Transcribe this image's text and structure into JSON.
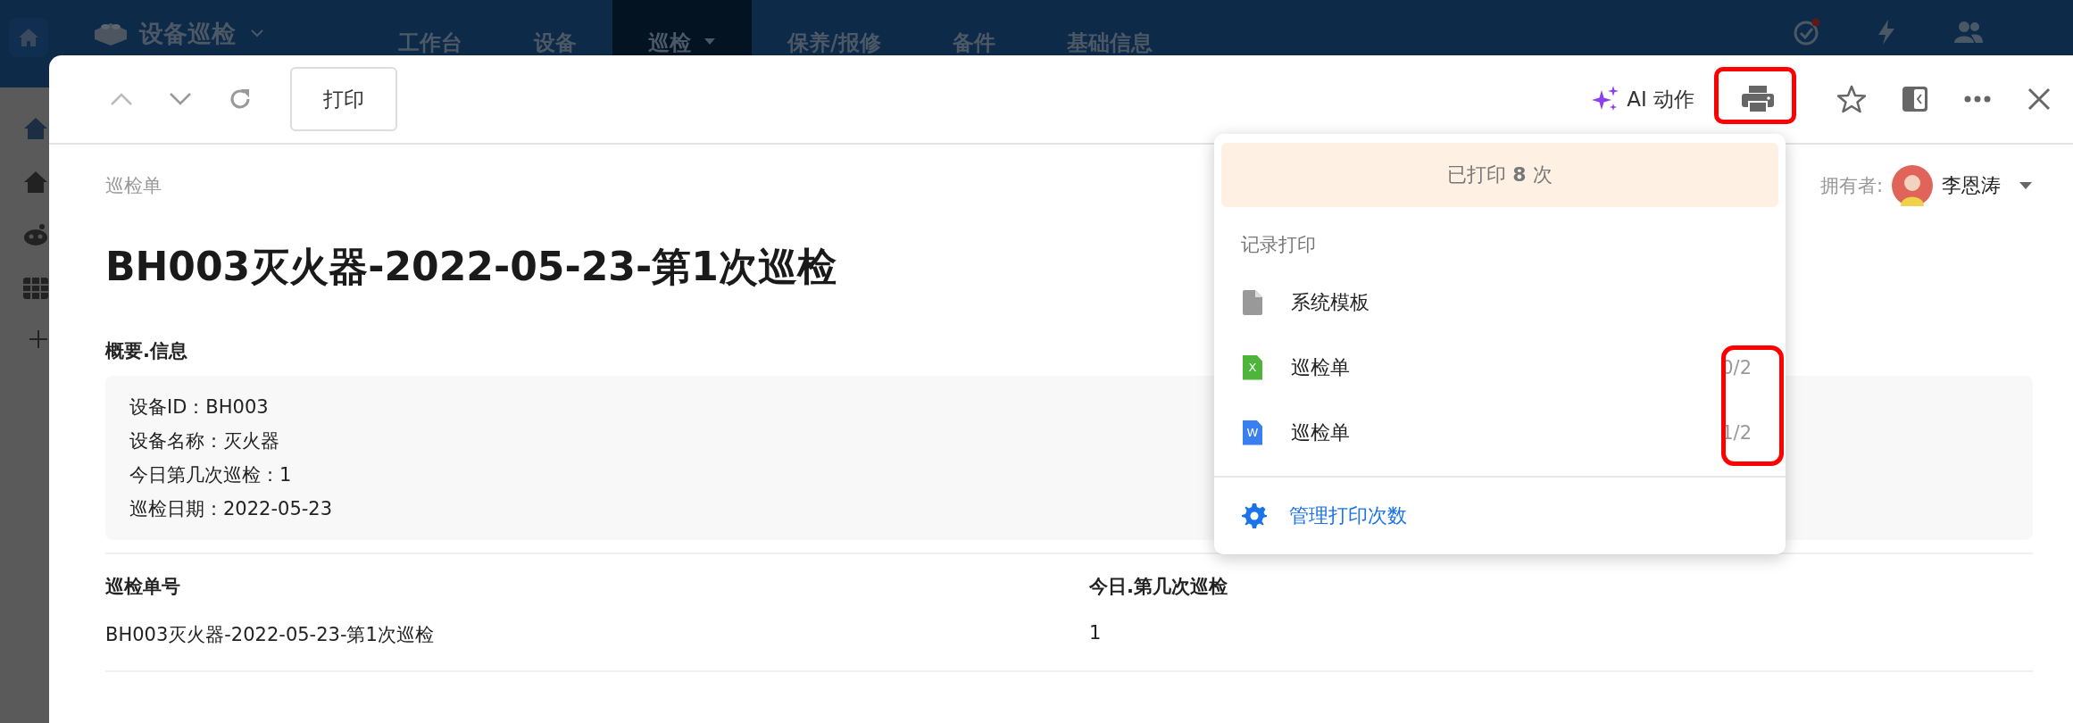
{
  "app_bar": {
    "title": "设备巡检",
    "nav": [
      {
        "label": "工作台",
        "selected": false,
        "has_menu": false
      },
      {
        "label": "设备",
        "selected": false,
        "has_menu": false
      },
      {
        "label": "巡检",
        "selected": true,
        "has_menu": true
      },
      {
        "label": "保养/报修",
        "selected": false,
        "has_menu": false
      },
      {
        "label": "备件",
        "selected": false,
        "has_menu": false
      },
      {
        "label": "基础信息",
        "selected": false,
        "has_menu": false
      }
    ]
  },
  "dialog": {
    "toolbar": {
      "print_button": "打印",
      "ai_action": "AI 动作"
    },
    "record_type": "巡检单",
    "owner": {
      "label": "拥有者:",
      "name": "李恩涛"
    },
    "title": "BH003灭火器-2022-05-23-第1次巡检",
    "summary": {
      "heading": "概要.信息",
      "lines": [
        "设备ID：BH003",
        "设备名称：灭火器",
        "今日第几次巡检：1",
        "巡检日期：2022-05-23"
      ]
    },
    "table": {
      "columns": [
        "巡检单号",
        "今日.第几次巡检"
      ],
      "rows": [
        [
          "BH003灭火器-2022-05-23-第1次巡检",
          "1"
        ]
      ]
    }
  },
  "print_menu": {
    "count_text": "已打印 **8** 次",
    "section_label": "记录打印",
    "templates": [
      {
        "kind": "system",
        "name": "系统模板"
      },
      {
        "kind": "excel",
        "badge": "X",
        "name": "巡检单",
        "count": "0/2"
      },
      {
        "kind": "word",
        "badge": "W",
        "name": "巡检单",
        "count": "1/2"
      }
    ],
    "manage_link": "管理打印次数"
  }
}
